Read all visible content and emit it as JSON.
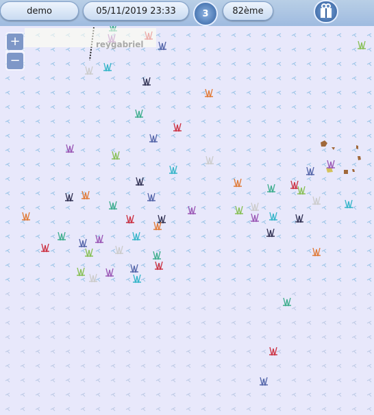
{
  "topbar": {
    "user_label": "demo",
    "datetime_label": "05/11/2019 23:33",
    "speed_value": "3",
    "rank_label": "82ème"
  },
  "zoom": {
    "in_label": "+",
    "out_label": "−"
  },
  "map": {
    "player_label": "reygabriel",
    "boat_colors": [
      "#3fae8e",
      "#cc3344",
      "#5566aa",
      "#9b59b6",
      "#88c057",
      "#cccccc",
      "#36b5c9",
      "#333355",
      "#e07b39"
    ]
  }
}
